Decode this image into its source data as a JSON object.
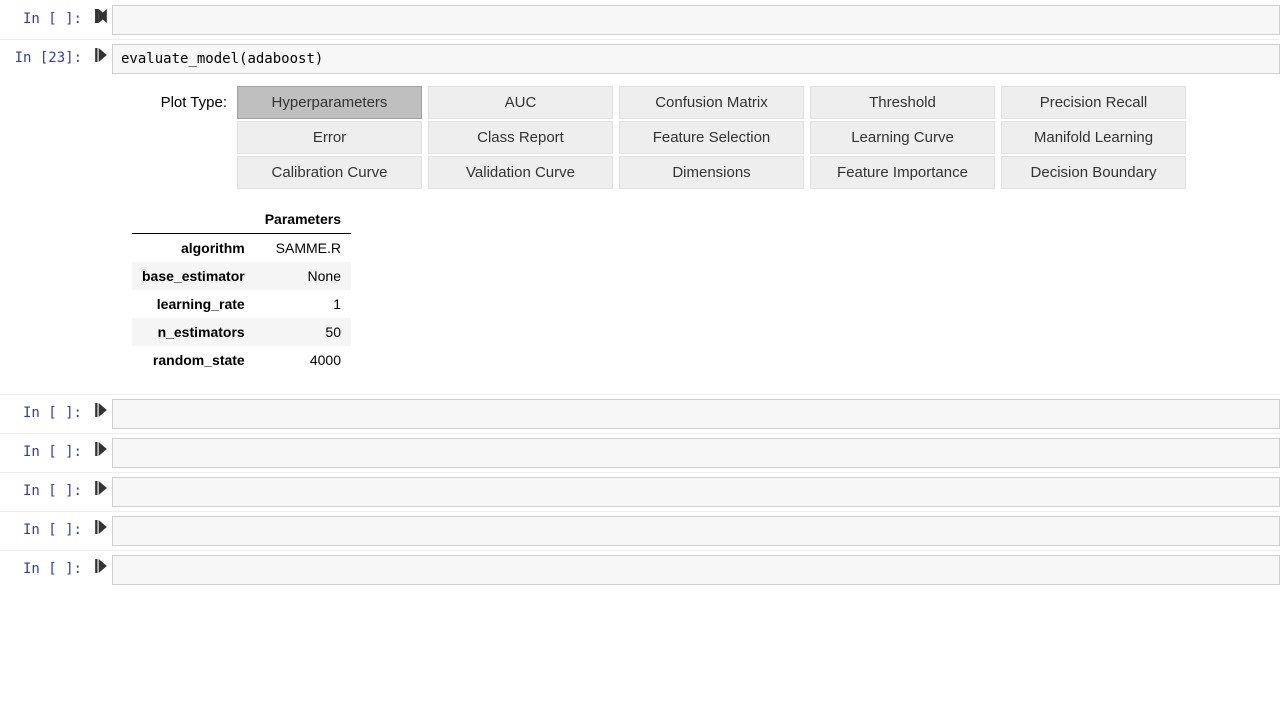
{
  "cells": {
    "c0": {
      "prompt": "In [ ]:",
      "code": ""
    },
    "c1": {
      "prompt": "In [23]:",
      "code_fn": "evaluate_model",
      "code_arg": "adaboost"
    },
    "c2": {
      "prompt": "In [ ]:",
      "code": ""
    },
    "c3": {
      "prompt": "In [ ]:",
      "code": ""
    },
    "c4": {
      "prompt": "In [ ]:",
      "code": ""
    },
    "c5": {
      "prompt": "In [ ]:",
      "code": ""
    },
    "c6": {
      "prompt": "In [ ]:",
      "code": ""
    }
  },
  "widget": {
    "label": "Plot Type:",
    "options": {
      "r0c0": "Hyperparameters",
      "r0c1": "AUC",
      "r0c2": "Confusion Matrix",
      "r0c3": "Threshold",
      "r0c4": "Precision Recall",
      "r1c0": "Error",
      "r1c1": "Class Report",
      "r1c2": "Feature Selection",
      "r1c3": "Learning Curve",
      "r1c4": "Manifold Learning",
      "r2c0": "Calibration Curve",
      "r2c1": "Validation Curve",
      "r2c2": "Dimensions",
      "r2c3": "Feature Importance",
      "r2c4": "Decision Boundary"
    },
    "selected": "Hyperparameters"
  },
  "params_table": {
    "header": "Parameters",
    "rows": {
      "r0": {
        "name": "algorithm",
        "value": "SAMME.R"
      },
      "r1": {
        "name": "base_estimator",
        "value": "None"
      },
      "r2": {
        "name": "learning_rate",
        "value": "1"
      },
      "r3": {
        "name": "n_estimators",
        "value": "50"
      },
      "r4": {
        "name": "random_state",
        "value": "4000"
      }
    }
  }
}
